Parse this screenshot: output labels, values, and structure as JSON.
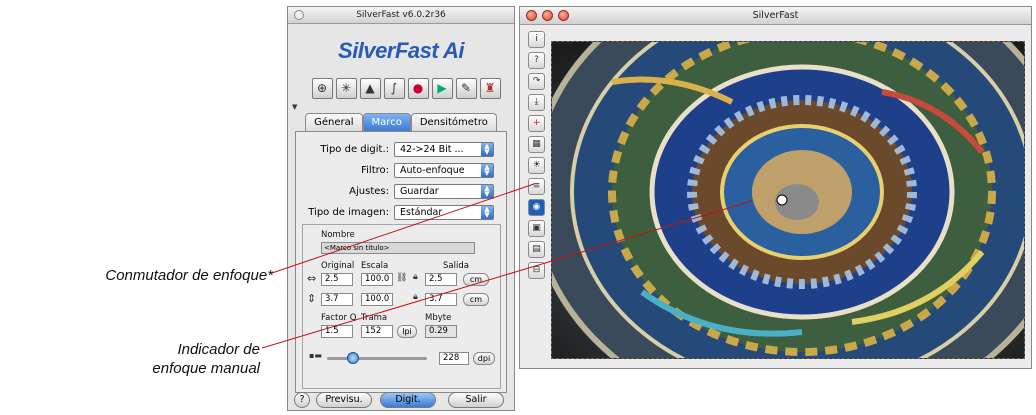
{
  "callouts": {
    "focus_toggle": "Conmutador de enfoque*",
    "manual_focus_line1": "Indicador de",
    "manual_focus_line2": "enfoque manual"
  },
  "panel": {
    "title": "SilverFast v6.0.2r36",
    "brand": "SilverFast Ai",
    "tools": [
      "magnifier-icon",
      "aperture-icon",
      "histogram-icon",
      "curve-icon",
      "color-wheel-icon",
      "selective-color-icon",
      "pipette-icon",
      "cap-icon"
    ],
    "tabs": [
      "Géneral",
      "Marco",
      "Densitómetro"
    ],
    "active_tab": "Marco",
    "fields": [
      {
        "label": "Tipo de digit.:",
        "value": "42->24 Bit ..."
      },
      {
        "label": "Filtro:",
        "value": "Auto-enfoque"
      },
      {
        "label": "Ajustes:",
        "value": "Guardar"
      },
      {
        "label": "Tipo de imagen:",
        "value": "Estándar"
      }
    ],
    "nombre_label": "Nombre",
    "nombre_value": "<Marco sin título>",
    "original_label": "Original",
    "escala_label": "Escala",
    "salida_label": "Salida",
    "width_original": "2.5",
    "width_escala": "100.0",
    "width_salida": "2.5",
    "height_original": "3.7",
    "height_escala": "100.0",
    "height_salida": "3.7",
    "unit": "cm",
    "factorq_label": "Factor Q",
    "trama_label": "Trama",
    "mbyte_label": "Mbyte",
    "factorq_value": "1.5",
    "trama_value": "152",
    "trama_unit": "lpi",
    "mbyte_value": "0.29",
    "resolution_value": "228",
    "resolution_unit": "dpi",
    "buttons": {
      "preview": "Previsu.",
      "scan": "Digit.",
      "exit": "Salir"
    }
  },
  "window": {
    "title": "SilverFast",
    "vtools": [
      "i",
      "?",
      "↷",
      "⤓",
      "+",
      "▦",
      "☀",
      "≡",
      "◉",
      "▣",
      "▤",
      "⊟"
    ]
  },
  "colors": {
    "accent": "#3b7ad6",
    "callout_line": "#c41212"
  }
}
